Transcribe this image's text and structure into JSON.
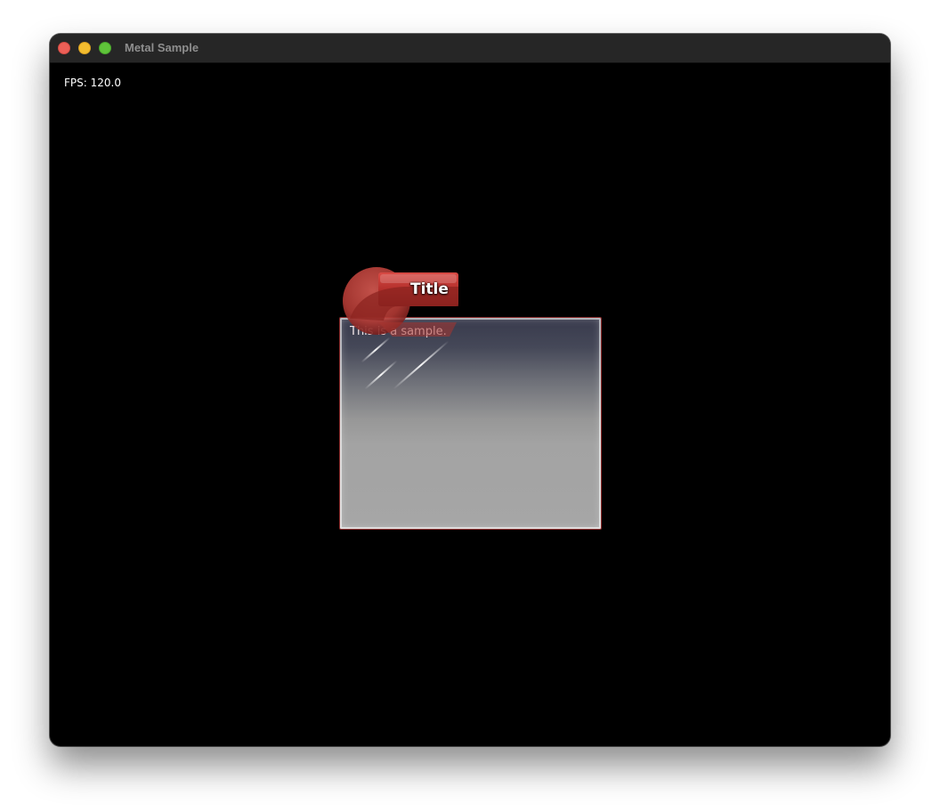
{
  "window": {
    "title": "Metal Sample"
  },
  "overlay": {
    "fps_text": "FPS: 120.0"
  },
  "widget": {
    "title": "Title",
    "body_text": "This is a sample."
  },
  "colors": {
    "traffic_close": "#ec5f57",
    "traffic_minimize": "#f4bd2f",
    "traffic_maximize": "#5fc43a",
    "accent_red": "#b8302e",
    "background": "#000000"
  }
}
